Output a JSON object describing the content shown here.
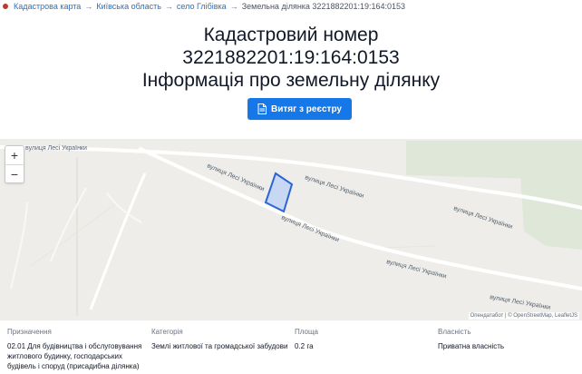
{
  "breadcrumb": {
    "items": [
      "Кадастрова карта",
      "Київська область",
      "село Глібівка"
    ],
    "separator": "→",
    "current": "Земельна ділянка 3221882201:19:164:0153"
  },
  "header": {
    "line1": "Кадастровий номер",
    "line2": "3221882201:19:164:0153",
    "line3": "Інформація про земельну ділянку"
  },
  "actions": {
    "extract_button": "Витяг з реєстру"
  },
  "map": {
    "zoom_in": "+",
    "zoom_out": "−",
    "street_labels": [
      "вулиця Лесі Українки",
      "вулиця Лесі Українки",
      "вулиця Лесі Українки",
      "вулиця Лесі Українки",
      "вулиця Лесі Українки",
      "вулиця Лесі Українки",
      "вулиця Лесі Українки",
      "вулиця Лесі Українки"
    ],
    "attribution": "Опендатабот | © OpenStreetMap, LeafletJS",
    "parcel_color": "#2b64d9"
  },
  "info": {
    "purpose_label": "Призначення",
    "purpose_value": "02.01 Для будівництва і обслуговування житлового будинку, господарських будівель і споруд (присадибна ділянка)",
    "category_label": "Категорія",
    "category_value": "Землі житлової та громадської забудови",
    "area_label": "Площа",
    "area_value": "0.2 га",
    "ownership_label": "Власність",
    "ownership_value": "Приватна власність"
  }
}
